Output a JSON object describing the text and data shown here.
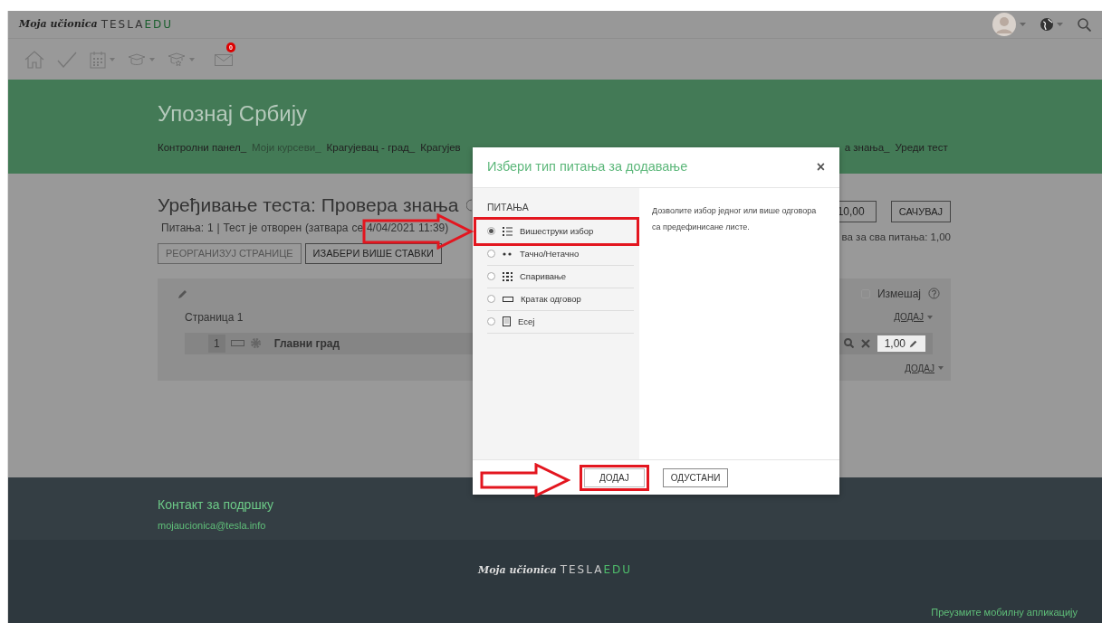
{
  "brand": {
    "script": "Moja učionica",
    "logo_a": "TESLA",
    "logo_b": "EDU"
  },
  "toolbar": {
    "message_count": "0"
  },
  "course_title": "Упознај Србију",
  "breadcrumb": [
    {
      "label": "Контролни панел_",
      "faded": false
    },
    {
      "label": "Моји курсеви_",
      "faded": true
    },
    {
      "label": "Крагујевац - град_",
      "faded": false
    },
    {
      "label": "Крагујев",
      "faded": false
    }
  ],
  "breadcrumb_tail": [
    {
      "label": "а знања_"
    },
    {
      "label": "Уреди тест"
    }
  ],
  "page_title": "Уређивање теста: Провера знања",
  "info": "Питања: 1 | Тест је отворен (затвара се 4/04/2021 11:39)",
  "buttons": [
    {
      "label": "РЕОРГАНИЗУЈ СТРАНИЦЕ",
      "disabled": true
    },
    {
      "label": "ИЗАБЕРИ ВИШЕ СТАВКИ",
      "disabled": false
    }
  ],
  "max_grade": {
    "value": "10,00",
    "button": "САЧУВАЈ"
  },
  "total": "ва за сва питања: 1,00",
  "shuffle": {
    "label": "Измешај",
    "checked": false
  },
  "page_label": "Страница 1",
  "add_top": "ДОДАЈ",
  "question": {
    "number": "1",
    "name": "Главни град",
    "mark": "1,00"
  },
  "add_bottom": "ДОДАЈ",
  "modal": {
    "title": "Избери тип питања за додавање",
    "section": "ПИТАЊА",
    "options": [
      {
        "label": "Вишеструки избор",
        "kind": "multichoice",
        "selected": true,
        "highlighted": true
      },
      {
        "label": "Тачно/Нетачно",
        "kind": "truefalse",
        "selected": false,
        "highlighted": false
      },
      {
        "label": "Спаривање",
        "kind": "match",
        "selected": false,
        "highlighted": false
      },
      {
        "label": "Кратак одговор",
        "kind": "shortanswer",
        "selected": false,
        "highlighted": false
      },
      {
        "label": "Есеј",
        "kind": "essay",
        "selected": false,
        "highlighted": false
      }
    ],
    "close": "×",
    "description": "Дозволите избор једног или више одговора са предефинисане листе.",
    "buttons": [
      {
        "label": "ДОДАЈ",
        "kind": "primary",
        "highlighted": true
      },
      {
        "label": "ОДУСТАНИ",
        "kind": "cancel",
        "highlighted": false
      }
    ]
  },
  "footer": {
    "contact_title": "Контакт за подршку",
    "email": "mojaucionica@tesla.info",
    "logo_script": "Moja učionica",
    "logo_a": "TESLA",
    "logo_b": "EDU",
    "app_link": "Преузмите мобилну апликацију"
  }
}
